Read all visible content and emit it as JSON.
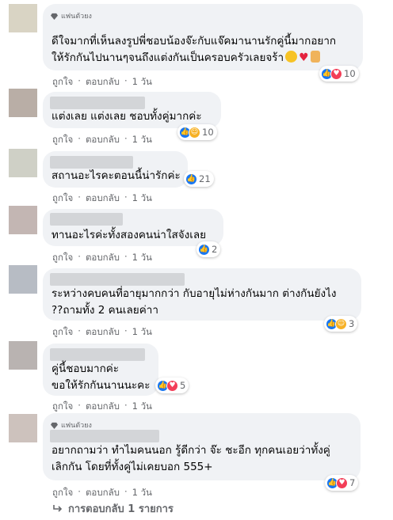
{
  "comments": [
    {
      "badge": "แฟนตัวยง",
      "lines": [
        "ดีใจมากที่เห็นลงรูปพี่ชอบน้องจ๊ะกับแจ๊คมานานรักคู่นี้มากอยาก",
        "ให้รักกันไปนานๆจนถึงแต่งกันเป็นครอบครัวเลยจร้า"
      ],
      "emojis": [
        "smile-emoji",
        "heart-emoji",
        "rock-hand-emoji"
      ],
      "like": "ถูกใจ",
      "reply": "ตอบกลับ",
      "time": "1 วัน",
      "reactions": [
        "like",
        "love"
      ],
      "count": "10"
    },
    {
      "lines": [
        "แต่งเลย แต่งเลย ชอบทั้งคู่มากค่ะ"
      ],
      "like": "ถูกใจ",
      "reply": "ตอบกลับ",
      "time": "1 วัน",
      "reactions": [
        "like",
        "care"
      ],
      "count": "10"
    },
    {
      "lines": [
        "สถานอะไรคะตอนนี้น่ารักค่ะ"
      ],
      "like": "ถูกใจ",
      "reply": "ตอบกลับ",
      "time": "1 วัน",
      "reactions": [
        "like"
      ],
      "count": "21"
    },
    {
      "lines": [
        "ทานอะไรค่ะทั้งสองคนน่าใสจังเลย"
      ],
      "like": "ถูกใจ",
      "reply": "ตอบกลับ",
      "time": "1 วัน",
      "reactions": [
        "like"
      ],
      "count": "2"
    },
    {
      "lines": [
        "ระหว่างคบคนที่อายุมากกว่า กับอายุไม่ห่างกันมาก ต่างกันยังไง",
        "??ถามทั้ง 2 คนเลยค่าา"
      ],
      "like": "ถูกใจ",
      "reply": "ตอบกลับ",
      "time": "1 วัน",
      "reactions": [
        "like",
        "haha"
      ],
      "count": "3"
    },
    {
      "lines": [
        "คู่นี้ชอบมากค่ะ",
        "ขอให้รักกันนานนะคะ"
      ],
      "like": "ถูกใจ",
      "reply": "ตอบกลับ",
      "time": "1 วัน",
      "reactions": [
        "like",
        "love"
      ],
      "count": "5"
    },
    {
      "badge": "แฟนตัวยง",
      "lines": [
        "อยากถามว่า ทำไมคนนอก รู้ดีกว่า จ๊ะ ชะอีก ทุกคนเอยว่าทั้งคู่",
        "เลิกกัน โดยที่ทั้งคู่ไม่เคยบอก 555+"
      ],
      "like": "ถูกใจ",
      "reply": "ตอบกลับ",
      "time": "1 วัน",
      "reactions": [
        "like",
        "love"
      ],
      "count": "7"
    }
  ],
  "replies_label": "การตอบกลับ 1 รายการ",
  "separator": "·",
  "colors": {
    "bubble": "#f0f2f5",
    "like": "#1877f2",
    "love": "#f33e58",
    "meta": "#65676b"
  }
}
